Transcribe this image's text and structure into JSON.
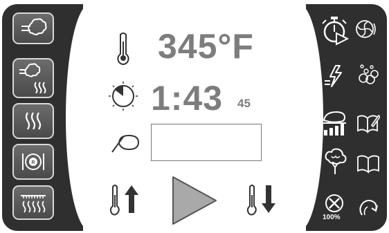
{
  "display": {
    "temperature": "345°F",
    "time_main": "1:43",
    "time_seconds": "45",
    "probe_value": ""
  },
  "left_buttons": [
    {
      "name": "steam-mode-button",
      "icon": "steam-cloud-icon"
    },
    {
      "name": "combi-mode-button",
      "icon": "steam-heat-icon"
    },
    {
      "name": "convection-mode-button",
      "icon": "heat-waves-icon"
    },
    {
      "name": "retherm-mode-button",
      "icon": "plate-retherm-icon"
    },
    {
      "name": "grill-mode-button",
      "icon": "grill-heat-icon"
    }
  ],
  "right_icons": [
    {
      "name": "timer-start-button",
      "icon": "stopwatch-play-icon"
    },
    {
      "name": "turbine-fan-button",
      "icon": "fan-icon"
    },
    {
      "name": "power-steam-button",
      "icon": "lightning-steam-icon"
    },
    {
      "name": "humidity-button",
      "icon": "bubbles-icon"
    },
    {
      "name": "chicken-cook-button",
      "icon": "chicken-graph-icon"
    },
    {
      "name": "recipe-edit-button",
      "icon": "book-pencil-icon"
    },
    {
      "name": "cool-down-button",
      "icon": "cloud-cooling-icon"
    },
    {
      "name": "recipe-book-button",
      "icon": "book-icon"
    },
    {
      "name": "fan-speed-button",
      "icon": "fan-speed-icon"
    },
    {
      "name": "back-button",
      "icon": "return-arrow-icon"
    }
  ],
  "fan_speed_label": "100%",
  "colors": {
    "panel": "#2f2f2f",
    "text": "#7d7d7d",
    "play": "#a9a9a9"
  }
}
